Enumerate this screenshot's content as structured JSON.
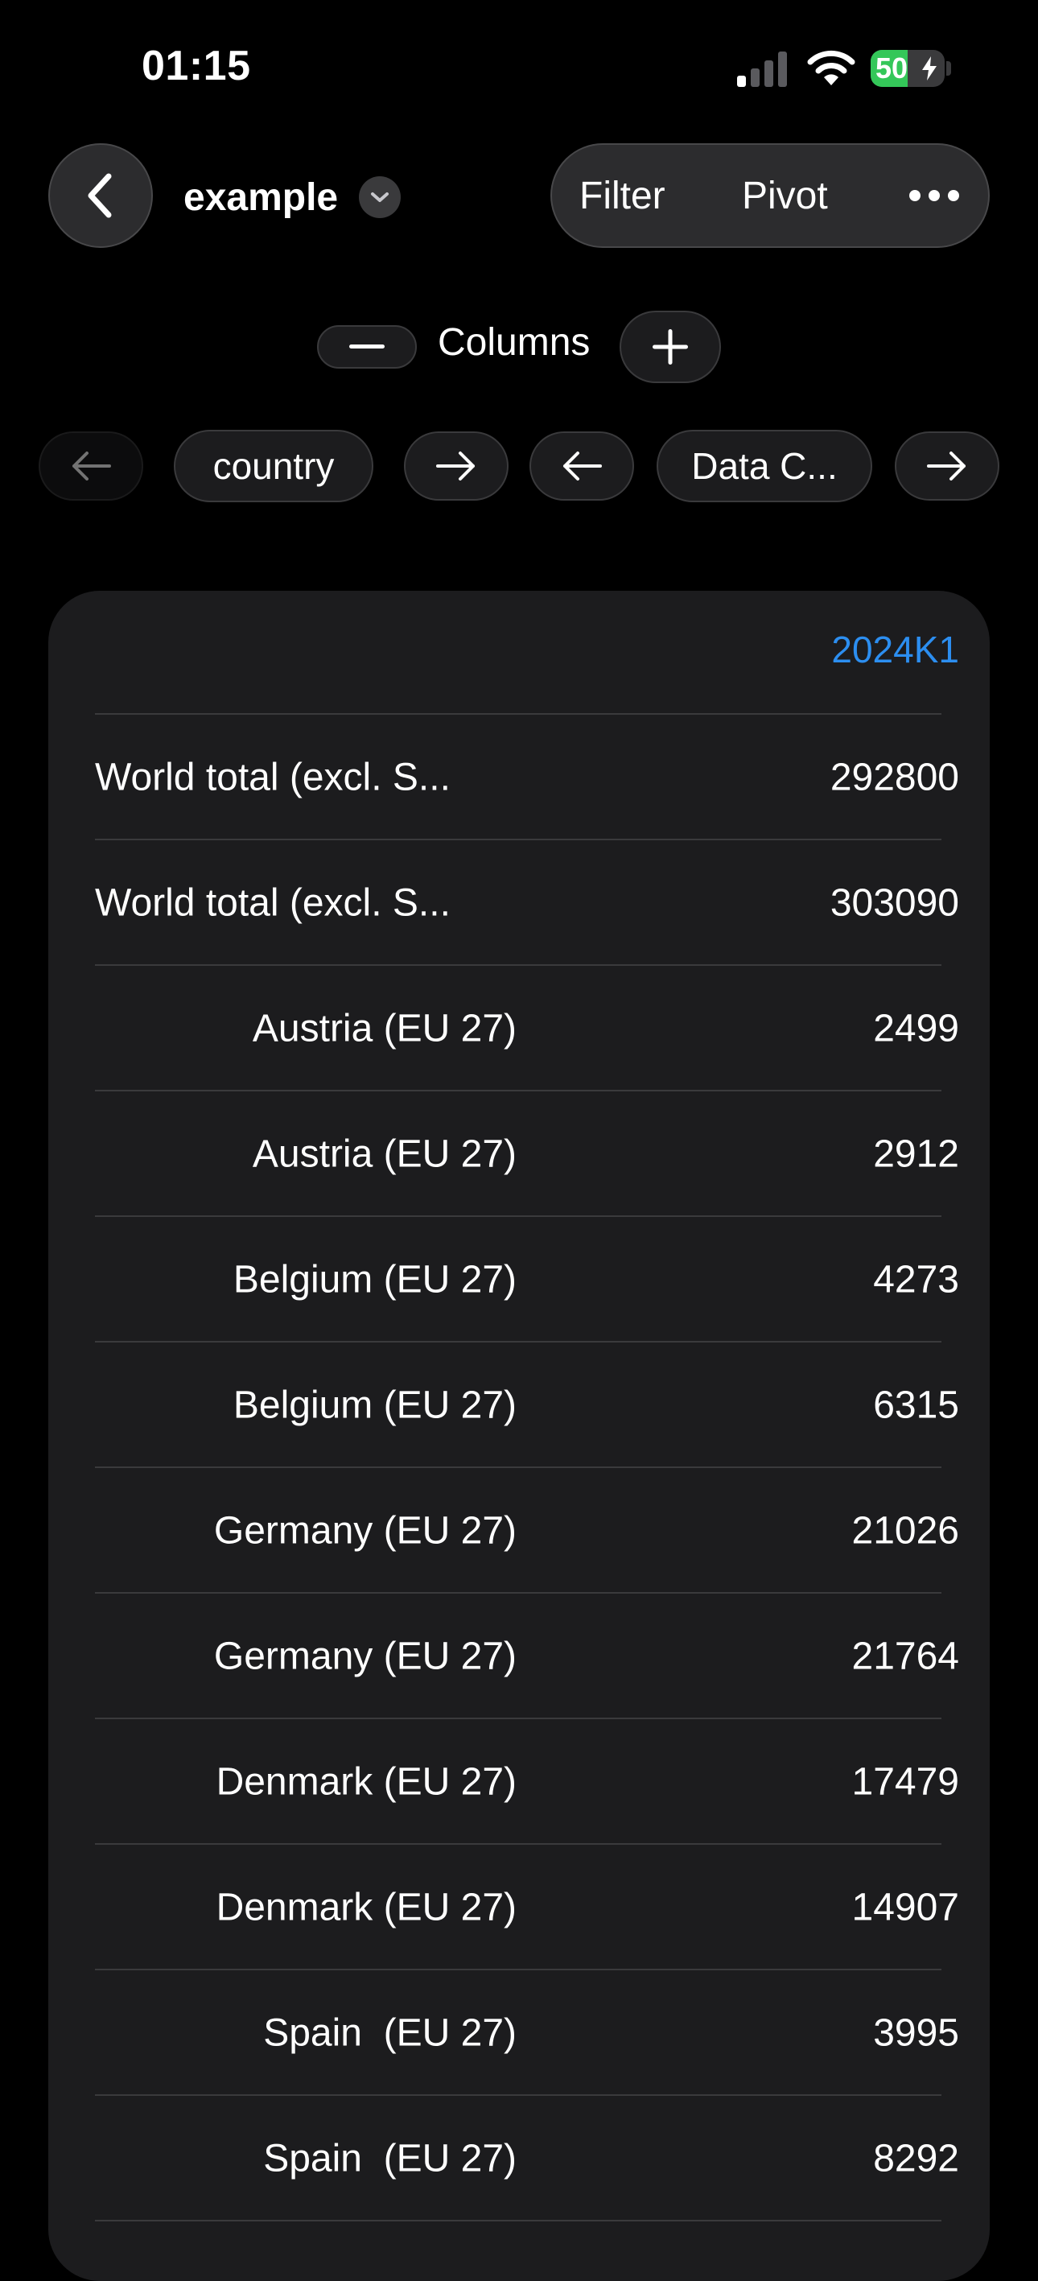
{
  "status_bar": {
    "time": "01:15",
    "battery_percent": "50",
    "battery_level": 0.5,
    "battery_color": "#34c759",
    "icons": [
      "cellular-signal-icon",
      "wifi-icon",
      "battery-charging-icon"
    ]
  },
  "nav": {
    "back_icon": "chevron-left-icon",
    "title": "example",
    "title_menu_icon": "chevron-down-icon",
    "filter_label": "Filter",
    "pivot_label": "Pivot",
    "more_icon": "ellipsis-icon"
  },
  "columns_control": {
    "label": "Columns",
    "minus_icon": "minus-icon",
    "plus_icon": "plus-icon"
  },
  "column_chips": {
    "left_arrow_disabled_icon": "arrow-left-icon",
    "first": "country",
    "second": "Data C...",
    "arrow_right_icon": "arrow-right-icon",
    "arrow_left_icon": "arrow-left-icon"
  },
  "table": {
    "accent": "#2c8ef0",
    "column_header": "2024K1",
    "rows": [
      {
        "label": "World total (excl. S...",
        "value": "292800"
      },
      {
        "label": "World total (excl. S...",
        "value": "303090"
      },
      {
        "label": "Austria (EU 27)",
        "value": "2499"
      },
      {
        "label": "Austria (EU 27)",
        "value": "2912"
      },
      {
        "label": "Belgium (EU 27)",
        "value": "4273"
      },
      {
        "label": "Belgium (EU 27)",
        "value": "6315"
      },
      {
        "label": "Germany (EU 27)",
        "value": "21026"
      },
      {
        "label": "Germany (EU 27)",
        "value": "21764"
      },
      {
        "label": "Denmark (EU 27)",
        "value": "17479"
      },
      {
        "label": "Denmark (EU 27)",
        "value": "14907"
      },
      {
        "label": "Spain  (EU 27)",
        "value": "3995"
      },
      {
        "label": "Spain  (EU 27)",
        "value": "8292"
      }
    ]
  }
}
